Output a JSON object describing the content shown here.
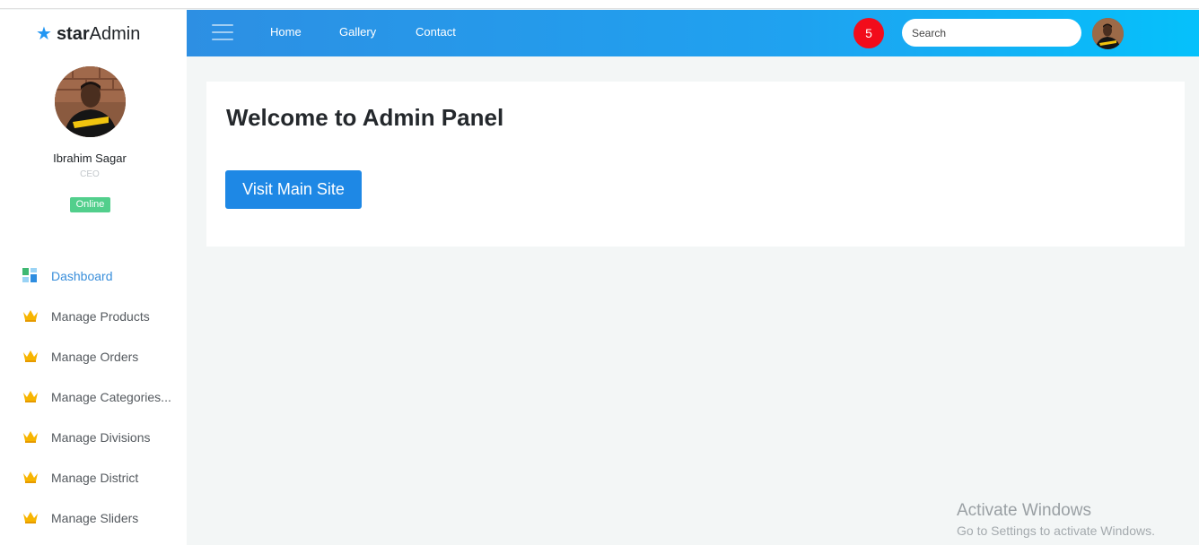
{
  "brand": {
    "prefix": "star",
    "suffix": "Admin",
    "icon": "star-icon",
    "color": "#2196f3"
  },
  "user": {
    "name": "Ibrahim Sagar",
    "role": "CEO",
    "status": "Online",
    "status_color": "#52cf8c"
  },
  "sidebar": {
    "items": [
      {
        "label": "Dashboard",
        "icon": "dashboard-icon",
        "active": true
      },
      {
        "label": "Manage Products",
        "icon": "crown-icon"
      },
      {
        "label": "Manage Orders",
        "icon": "crown-icon"
      },
      {
        "label": "Manage Categories...",
        "icon": "crown-icon"
      },
      {
        "label": "Manage Divisions",
        "icon": "crown-icon"
      },
      {
        "label": "Manage District",
        "icon": "crown-icon"
      },
      {
        "label": "Manage Sliders",
        "icon": "crown-icon"
      }
    ]
  },
  "topbar": {
    "links": [
      "Home",
      "Gallery",
      "Contact"
    ],
    "notification_count": "5",
    "search": {
      "placeholder": "Search",
      "value": ""
    },
    "gradient": [
      "#2d8fe3",
      "#05c1fb"
    ]
  },
  "main": {
    "title": "Welcome to Admin Panel",
    "button_label": "Visit Main Site",
    "button_color": "#1e88e5"
  },
  "watermark": {
    "title": "Activate Windows",
    "subtitle": "Go to Settings to activate Windows."
  }
}
